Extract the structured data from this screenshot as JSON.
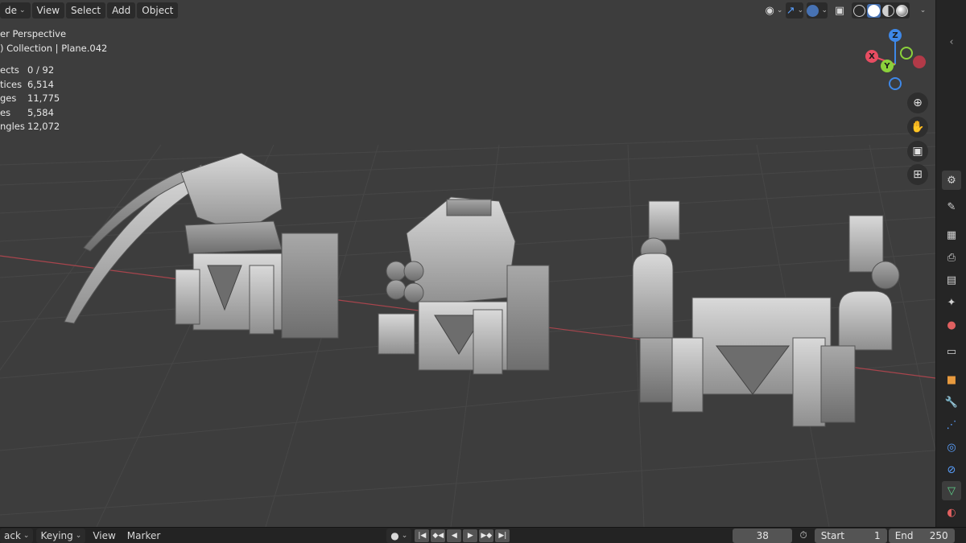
{
  "header": {
    "mode_label": "de",
    "menus": [
      "View",
      "Select",
      "Add",
      "Object"
    ]
  },
  "overlay": {
    "perspective": "er Perspective",
    "collection": ") Collection | Plane.042",
    "stats": [
      {
        "label": "ects",
        "value": "0 / 92"
      },
      {
        "label": "tices",
        "value": "6,514"
      },
      {
        "label": "ges",
        "value": "11,775"
      },
      {
        "label": "es",
        "value": "5,584"
      },
      {
        "label": "ngles",
        "value": "12,072"
      }
    ]
  },
  "gizmo": {
    "z": "Z",
    "y": "Y",
    "x": "X"
  },
  "timeline": {
    "playback_label": "ack",
    "keying_label": "Keying",
    "view_label": "View",
    "marker_label": "Marker",
    "current_frame": "38",
    "start_label": "Start",
    "start_value": "1",
    "end_label": "End",
    "end_value": "250"
  },
  "colors": {
    "accent": "#4772b3",
    "axis_x": "#e84d62",
    "axis_y": "#8bd13b",
    "axis_z": "#3e88e8",
    "viewport_bg": "#3d3d3d"
  }
}
